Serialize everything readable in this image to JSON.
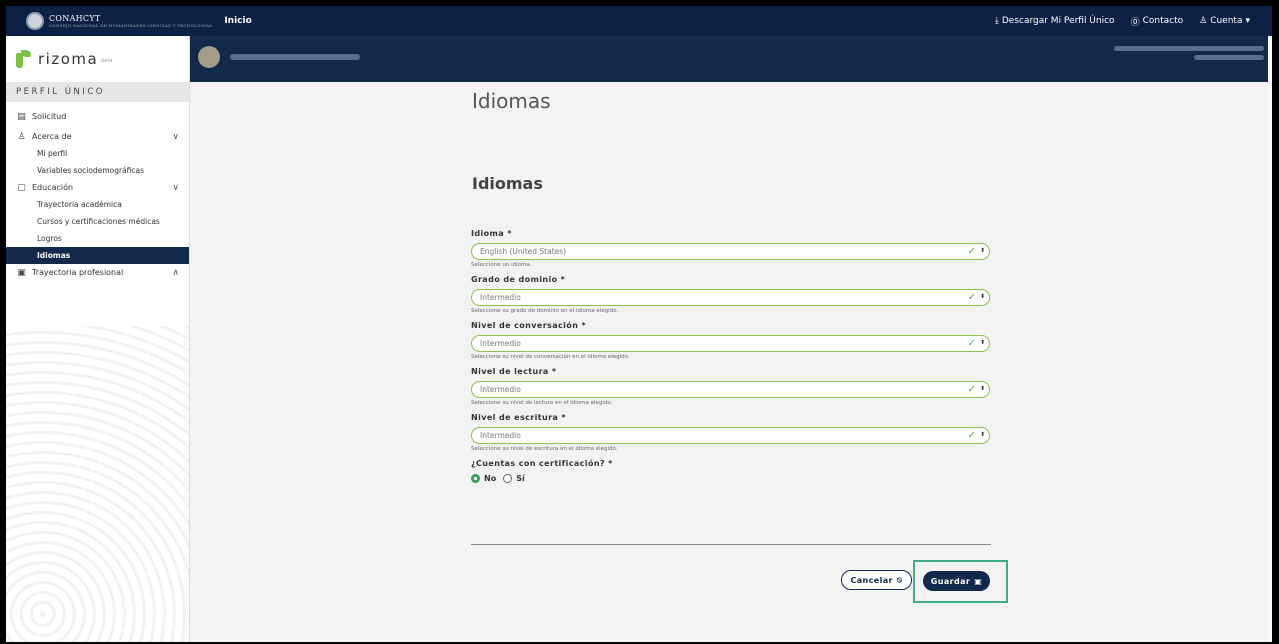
{
  "topbar": {
    "brand": "CONAHCYT",
    "brand_sub": "CONSEJO NACIONAL DE HUMANIDADES CIENCIAS Y TECNOLOGÍAS",
    "inicio": "Inicio",
    "descargar": "Descargar Mi Perfil Único",
    "contacto": "Contacto",
    "cuenta": "Cuenta"
  },
  "sidebar": {
    "logo": "rizoma",
    "logo_badge": "beta",
    "section": "PERFIL ÚNICO",
    "items": [
      {
        "label": "Solicitud"
      },
      {
        "label": "Acerca de"
      },
      {
        "label": "Mi perfil"
      },
      {
        "label": "Variables sociodemográficas"
      },
      {
        "label": "Educación"
      },
      {
        "label": "Trayectoria académica"
      },
      {
        "label": "Cursos y certificaciones médicas"
      },
      {
        "label": "Logros"
      },
      {
        "label": "Idiomas"
      },
      {
        "label": "Trayectoria profesional"
      }
    ]
  },
  "main": {
    "page_title": "Idiomas",
    "section_title": "Idiomas",
    "fields": [
      {
        "label": "Idioma *",
        "value": "English (United States)",
        "helper": "Seleccione un idioma."
      },
      {
        "label": "Grado de dominio *",
        "value": "Intermedio",
        "helper": "Seleccione su grado de dominio en el idioma elegido."
      },
      {
        "label": "Nivel de conversación *",
        "value": "Intermedio",
        "helper": "Seleccione su nivel de conversación en el idioma elegido."
      },
      {
        "label": "Nivel de lectura *",
        "value": "Intermedio",
        "helper": "Seleccione su nivel de lectura en el idioma elegido."
      },
      {
        "label": "Nivel de escritura *",
        "value": "Intermedio",
        "helper": "Seleccione su nivel de escritura en el idioma elegido."
      }
    ],
    "certificacion": {
      "label": "¿Cuentas con certificación? *",
      "options": [
        "No",
        "Sí"
      ],
      "selected": "No"
    },
    "cancel_label": "Cancelar",
    "save_label": "Guardar"
  }
}
